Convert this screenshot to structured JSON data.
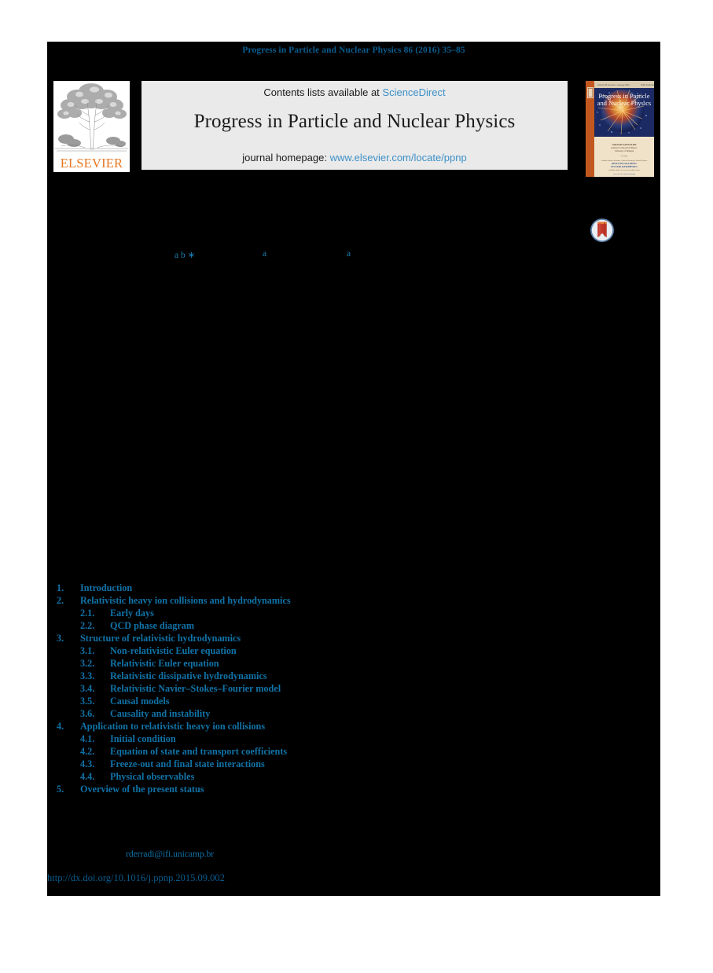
{
  "running_head": "Progress in Particle and Nuclear Physics 86 (2016) 35–85",
  "masthead": {
    "contents_prefix": "Contents lists available at ",
    "contents_link": "ScienceDirect",
    "journal_title": "Progress in Particle and Nuclear Physics",
    "homepage_prefix": "journal homepage: ",
    "homepage_link": "www.elsevier.com/locate/ppnp",
    "publisher_wordmark": "ELSEVIER",
    "cover_title_line1": "Progress in Particle",
    "cover_title_line2": "and Nuclear Physics"
  },
  "affiliations": [
    {
      "marker": "a b ∗"
    },
    {
      "marker": "a"
    },
    {
      "marker": "a"
    }
  ],
  "toc": [
    {
      "level": 1,
      "number": "1.",
      "label": "Introduction"
    },
    {
      "level": 1,
      "number": "2.",
      "label": "Relativistic heavy ion collisions and hydrodynamics"
    },
    {
      "level": 2,
      "number": "2.1.",
      "label": "Early days"
    },
    {
      "level": 2,
      "number": "2.2.",
      "label": "QCD phase diagram"
    },
    {
      "level": 1,
      "number": "3.",
      "label": "Structure of relativistic hydrodynamics"
    },
    {
      "level": 2,
      "number": "3.1.",
      "label": "Non-relativistic Euler equation"
    },
    {
      "level": 2,
      "number": "3.2.",
      "label": "Relativistic Euler equation"
    },
    {
      "level": 2,
      "number": "3.3.",
      "label": "Relativistic dissipative hydrodynamics"
    },
    {
      "level": 2,
      "number": "3.4.",
      "label": "Relativistic Navier–Stokes–Fourier model"
    },
    {
      "level": 2,
      "number": "3.5.",
      "label": "Causal models"
    },
    {
      "level": 2,
      "number": "3.6.",
      "label": "Causality and instability"
    },
    {
      "level": 1,
      "number": "4.",
      "label": "Application to relativistic heavy ion collisions"
    },
    {
      "level": 2,
      "number": "4.1.",
      "label": "Initial condition"
    },
    {
      "level": 2,
      "number": "4.2.",
      "label": "Equation of state and transport coefficients"
    },
    {
      "level": 2,
      "number": "4.3.",
      "label": "Freeze-out and final state interactions"
    },
    {
      "level": 2,
      "number": "4.4.",
      "label": "Physical observables"
    },
    {
      "level": 1,
      "number": "5.",
      "label": "Overview of the present status"
    }
  ],
  "footnote": {
    "email": "rderradi@ifi.unicamp.br"
  },
  "doi": "http://dx.doi.org/10.1016/j.ppnp.2015.09.002",
  "colors": {
    "page_mask": "#000000",
    "running_head": "#0a5c8e",
    "link_blue": "#3d90c7",
    "toc_blue": "#1073a8",
    "affil_blue": "#1a7fb3",
    "elsevier_orange": "#e87722",
    "band_grey": "#eaeaea",
    "cover_spine": "#c2581f"
  }
}
